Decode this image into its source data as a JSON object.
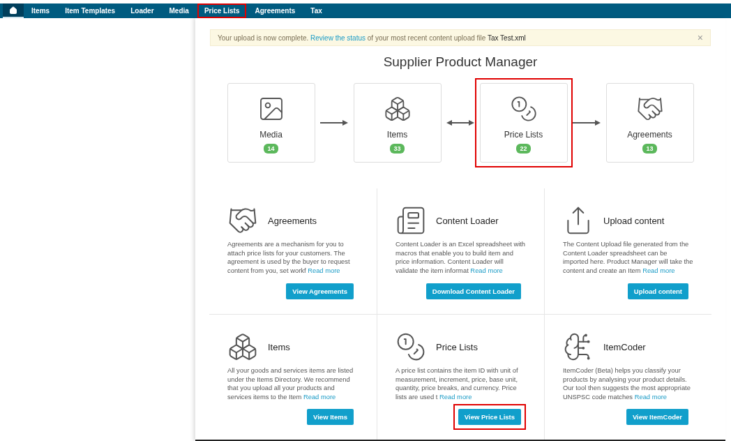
{
  "nav": {
    "home": {
      "selected": true
    },
    "tabs": [
      {
        "label": "Items",
        "highlighted": false
      },
      {
        "label": "Item Templates",
        "highlighted": false
      },
      {
        "label": "Loader",
        "highlighted": false
      },
      {
        "label": "Media",
        "highlighted": false
      },
      {
        "label": "Price Lists",
        "highlighted": true
      },
      {
        "label": "Agreements",
        "highlighted": false
      },
      {
        "label": "Tax",
        "highlighted": false
      }
    ]
  },
  "alert": {
    "text": "Your upload is now complete.",
    "link": "Review the status",
    "text_after": "of your most recent content upload file",
    "file": "Tax Test.xml",
    "close": "×"
  },
  "title": "Supplier Product Manager",
  "flow": [
    {
      "kind": "media",
      "label": "Media",
      "count": "14",
      "highlighted": false
    },
    {
      "kind": "items",
      "label": "Items",
      "count": "33",
      "highlighted": false
    },
    {
      "kind": "prices",
      "label": "Price Lists",
      "count": "22",
      "highlighted": true
    },
    {
      "kind": "agreements",
      "label": "Agreements",
      "count": "13",
      "highlighted": false
    }
  ],
  "connectors": [
    {
      "kind": "right"
    },
    {
      "kind": "both"
    },
    {
      "kind": "right"
    }
  ],
  "sections": [
    {
      "kind": "agreements",
      "title": "Agreements",
      "text": "Agreements are a mechanism for you to attach price lists for your customers. The agreement is used by the buyer to request content from you, set workf",
      "link": "Read more",
      "button": "View Agreements",
      "highlighted": false
    },
    {
      "kind": "loader",
      "title": "Content Loader",
      "text": "Content Loader is an Excel spreadsheet with macros that enable you to build item and price information. Content Loader will validate the item informat",
      "link": "Read more",
      "button": "Download Content Loader",
      "highlighted": false
    },
    {
      "kind": "upload",
      "title": "Upload content",
      "text": "The Content Upload file generated from the Content Loader spreadsheet can be imported here. Product Manager will take the content and create an Item",
      "link": "Read more",
      "button": "Upload content",
      "highlighted": false
    },
    {
      "kind": "items",
      "title": "Items",
      "text": "All your goods and services items are listed under the Items Directory. We recommend that you upload all your products and services items to the Item",
      "link": "Read more",
      "button": "View Items",
      "highlighted": false
    },
    {
      "kind": "prices",
      "title": "Price Lists",
      "text": "A price list contains the item ID with unit of measurement, increment, price, base unit, quantity, price breaks, and currency. Price lists are used t",
      "link": "Read more",
      "button": "View Price Lists",
      "highlighted": true
    },
    {
      "kind": "coder",
      "title": "ItemCoder",
      "text": "ItemCoder (Beta) helps you classify your products by analysing your product details. Our tool then suggests the most appropriate UNSPSC code matches",
      "link": "Read more",
      "button": "View ItemCoder",
      "highlighted": false
    }
  ]
}
